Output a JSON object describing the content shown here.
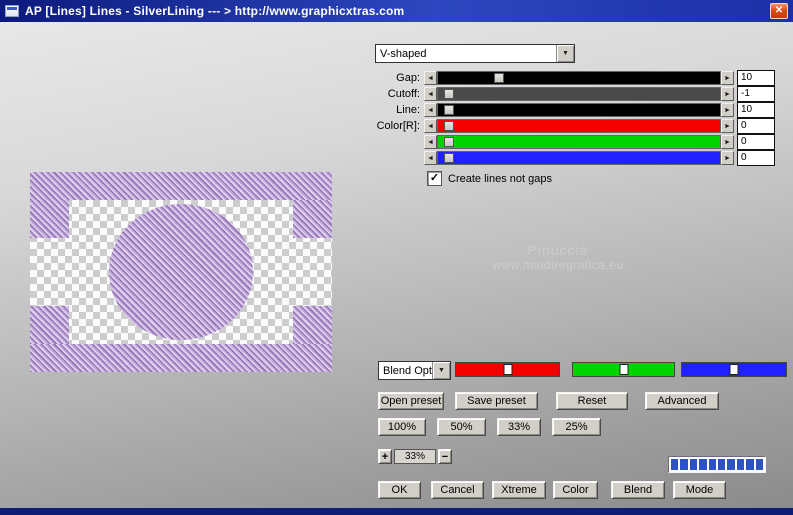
{
  "window": {
    "title": "AP [Lines]  Lines - SilverLining    --- > http://www.graphicxtras.com"
  },
  "icons": {
    "close": "✕",
    "dropdown": "▼",
    "arrow_left": "◄",
    "arrow_right": "►",
    "check": "✓"
  },
  "shape": {
    "selected": "V-shaped"
  },
  "sliders": [
    {
      "label": "Gap:",
      "value": "10",
      "color": "#000000",
      "thumb": 20
    },
    {
      "label": "Cutoff:",
      "value": "-1",
      "color": "#4a4a4a",
      "thumb": 2
    },
    {
      "label": "Line:",
      "value": "10",
      "color": "#000000",
      "thumb": 2
    },
    {
      "label": "Color[R]:",
      "value": "0",
      "color": "#f40000",
      "thumb": 2
    },
    {
      "label": "",
      "value": "0",
      "color": "#00d400",
      "thumb": 2
    },
    {
      "label": "",
      "value": "0",
      "color": "#2121ff",
      "thumb": 2
    }
  ],
  "options": {
    "create_lines_label": "Create lines not gaps",
    "checked": true
  },
  "watermark": {
    "line1": "Pinuccia",
    "line2": "www.maidiregrafica.eu"
  },
  "blend": {
    "dropdown": "Blend Opti",
    "channels": [
      {
        "name": "red",
        "color": "#f40000",
        "pos": 50
      },
      {
        "name": "green",
        "color": "#00d400",
        "pos": 50
      },
      {
        "name": "blue",
        "color": "#2121ff",
        "pos": 50
      }
    ]
  },
  "preset_row": [
    {
      "label": "Open preset"
    },
    {
      "label": "Save preset"
    },
    {
      "label": "Reset"
    },
    {
      "label": "Advanced"
    }
  ],
  "zoom_row": [
    {
      "label": "100%"
    },
    {
      "label": "50%"
    },
    {
      "label": "33%"
    },
    {
      "label": "25%"
    }
  ],
  "zoom_stepper": {
    "plus": "+",
    "value": "33%",
    "minus": "−"
  },
  "progress": {
    "segments": 10,
    "color": "#2d52c6"
  },
  "action_row": [
    {
      "label": "OK"
    },
    {
      "label": "Cancel"
    },
    {
      "label": "Xtreme"
    },
    {
      "label": "Color"
    },
    {
      "label": "Blend"
    },
    {
      "label": "Mode"
    }
  ]
}
